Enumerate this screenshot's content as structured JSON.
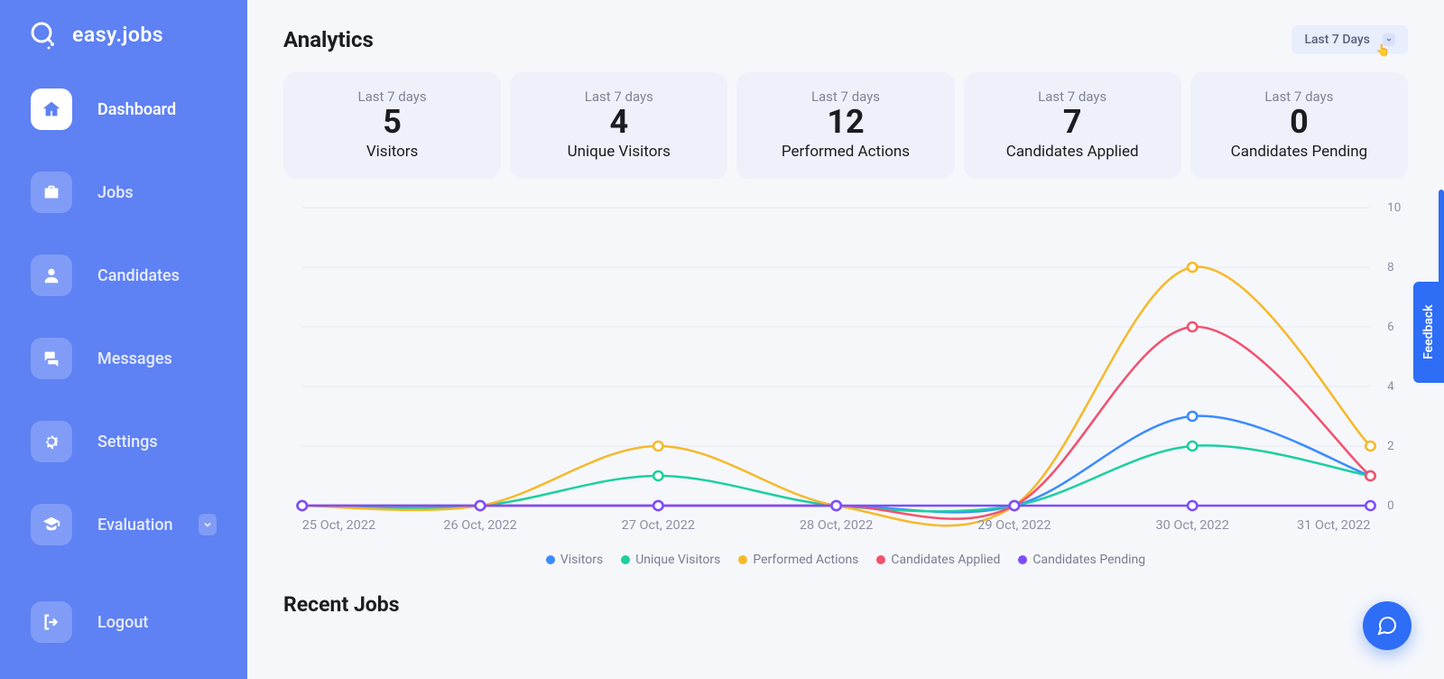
{
  "brand": {
    "text": "easy.jobs"
  },
  "sidebar": {
    "items": [
      {
        "label": "Dashboard"
      },
      {
        "label": "Jobs"
      },
      {
        "label": "Candidates"
      },
      {
        "label": "Messages"
      },
      {
        "label": "Settings"
      },
      {
        "label": "Evaluation"
      }
    ],
    "logout": "Logout"
  },
  "analytics": {
    "title": "Analytics",
    "range_label": "Last 7 Days"
  },
  "metrics": [
    {
      "period": "Last 7 days",
      "value": "5",
      "label": "Visitors"
    },
    {
      "period": "Last 7 days",
      "value": "4",
      "label": "Unique Visitors"
    },
    {
      "period": "Last 7 days",
      "value": "12",
      "label": "Performed Actions"
    },
    {
      "period": "Last 7 days",
      "value": "7",
      "label": "Candidates Applied"
    },
    {
      "period": "Last 7 days",
      "value": "0",
      "label": "Candidates Pending"
    }
  ],
  "legend": [
    {
      "label": "Visitors",
      "color": "#3b8bff"
    },
    {
      "label": "Unique Visitors",
      "color": "#1dcf9f"
    },
    {
      "label": "Performed Actions",
      "color": "#f6b92b"
    },
    {
      "label": "Candidates Applied",
      "color": "#f2526e"
    },
    {
      "label": "Candidates Pending",
      "color": "#7c4dff"
    }
  ],
  "chart_data": {
    "type": "line",
    "categories": [
      "25 Oct, 2022",
      "26 Oct, 2022",
      "27 Oct, 2022",
      "28 Oct, 2022",
      "29 Oct, 2022",
      "30 Oct, 2022",
      "31 Oct, 2022"
    ],
    "ylim": [
      0,
      10
    ],
    "yticks": [
      0,
      2,
      4,
      6,
      8,
      10
    ],
    "series": [
      {
        "name": "Visitors",
        "color": "#3b8bff",
        "values": [
          0,
          0,
          0,
          0,
          0,
          3,
          1
        ]
      },
      {
        "name": "Unique Visitors",
        "color": "#1dcf9f",
        "values": [
          0,
          0,
          1,
          0,
          0,
          2,
          1
        ]
      },
      {
        "name": "Performed Actions",
        "color": "#f6b92b",
        "values": [
          0,
          0,
          2,
          0,
          0,
          8,
          2
        ]
      },
      {
        "name": "Candidates Applied",
        "color": "#f2526e",
        "values": [
          0,
          0,
          0,
          0,
          0,
          6,
          1
        ]
      },
      {
        "name": "Candidates Pending",
        "color": "#7c4dff",
        "values": [
          0,
          0,
          0,
          0,
          0,
          0,
          0
        ]
      }
    ]
  },
  "recent_jobs_title": "Recent Jobs",
  "feedback_label": "Feedback"
}
